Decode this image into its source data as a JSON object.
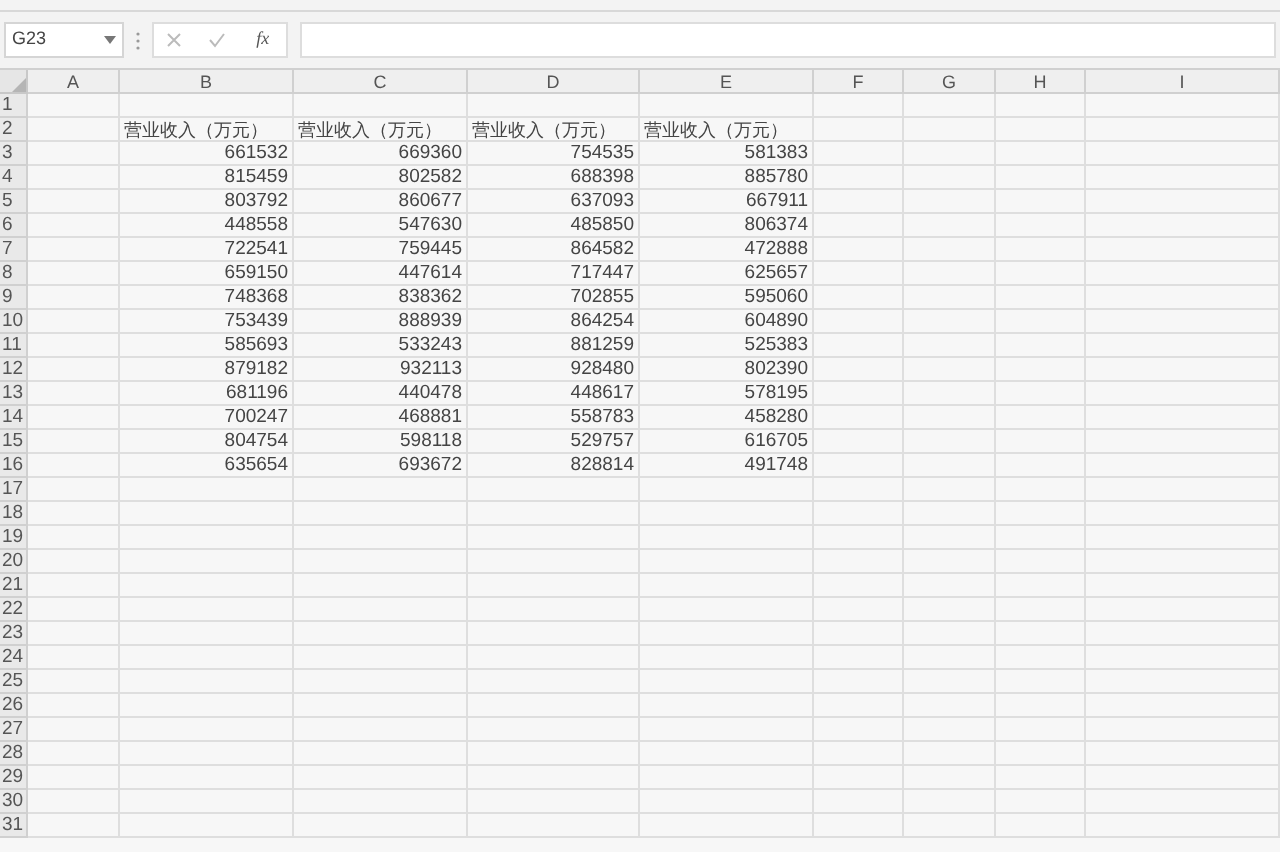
{
  "name_box": "G23",
  "function_button": "fx",
  "columns": [
    "A",
    "B",
    "C",
    "D",
    "E",
    "F",
    "G",
    "H",
    "I"
  ],
  "rows": [
    {
      "number": "1",
      "kind": "empty"
    },
    {
      "number": "2",
      "kind": "header",
      "cells": [
        "营业收入（万元）",
        "营业收入（万元）",
        "营业收入（万元）",
        "营业收入（万元）"
      ]
    },
    {
      "number": "3",
      "kind": "data",
      "cells": [
        "661532",
        "669360",
        "754535",
        "581383"
      ]
    },
    {
      "number": "4",
      "kind": "data",
      "cells": [
        "815459",
        "802582",
        "688398",
        "885780"
      ]
    },
    {
      "number": "5",
      "kind": "data",
      "cells": [
        "803792",
        "860677",
        "637093",
        "667911"
      ]
    },
    {
      "number": "6",
      "kind": "data",
      "cells": [
        "448558",
        "547630",
        "485850",
        "806374"
      ]
    },
    {
      "number": "7",
      "kind": "data",
      "cells": [
        "722541",
        "759445",
        "864582",
        "472888"
      ]
    },
    {
      "number": "8",
      "kind": "data",
      "cells": [
        "659150",
        "447614",
        "717447",
        "625657"
      ]
    },
    {
      "number": "9",
      "kind": "data",
      "cells": [
        "748368",
        "838362",
        "702855",
        "595060"
      ]
    },
    {
      "number": "10",
      "kind": "data",
      "cells": [
        "753439",
        "888939",
        "864254",
        "604890"
      ]
    },
    {
      "number": "11",
      "kind": "data",
      "cells": [
        "585693",
        "533243",
        "881259",
        "525383"
      ]
    },
    {
      "number": "12",
      "kind": "data",
      "cells": [
        "879182",
        "932113",
        "928480",
        "802390"
      ]
    },
    {
      "number": "13",
      "kind": "data",
      "cells": [
        "681196",
        "440478",
        "448617",
        "578195"
      ]
    },
    {
      "number": "14",
      "kind": "data",
      "cells": [
        "700247",
        "468881",
        "558783",
        "458280"
      ]
    },
    {
      "number": "15",
      "kind": "data",
      "cells": [
        "804754",
        "598118",
        "529757",
        "616705"
      ]
    },
    {
      "number": "16",
      "kind": "data",
      "cells": [
        "635654",
        "693672",
        "828814",
        "491748"
      ]
    },
    {
      "number": "17",
      "kind": "empty"
    },
    {
      "number": "18",
      "kind": "empty"
    },
    {
      "number": "19",
      "kind": "empty"
    },
    {
      "number": "20",
      "kind": "empty"
    },
    {
      "number": "21",
      "kind": "empty"
    },
    {
      "number": "22",
      "kind": "empty"
    },
    {
      "number": "23",
      "kind": "empty"
    },
    {
      "number": "24",
      "kind": "empty"
    },
    {
      "number": "25",
      "kind": "empty"
    },
    {
      "number": "26",
      "kind": "empty"
    },
    {
      "number": "27",
      "kind": "empty"
    },
    {
      "number": "28",
      "kind": "empty"
    },
    {
      "number": "29",
      "kind": "empty"
    },
    {
      "number": "30",
      "kind": "empty"
    },
    {
      "number": "31",
      "kind": "empty"
    }
  ]
}
